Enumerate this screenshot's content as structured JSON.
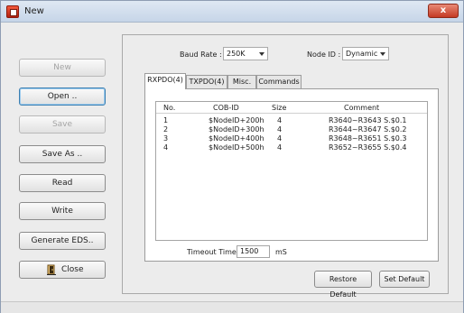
{
  "window": {
    "title": "New",
    "close_glyph": "x"
  },
  "sidebar": {
    "new": "New",
    "open": "Open ..",
    "save": "Save",
    "save_as": "Save As ..",
    "read": "Read",
    "write": "Write",
    "generate_eds": "Generate EDS..",
    "close": "Close"
  },
  "settings": {
    "baud_rate_label": "Baud Rate :",
    "baud_rate_value": "250K",
    "node_id_label": "Node ID :",
    "node_id_value": "Dynamic"
  },
  "tabs": [
    "RXPDO(4)",
    "TXPDO(4)",
    "Misc.",
    "Commands"
  ],
  "table": {
    "columns": [
      "No.",
      "COB-ID",
      "Size",
      "Comment"
    ],
    "rows": [
      [
        "1",
        "$NodeID+200h",
        "4",
        "R3640~R3643 S.$0.1"
      ],
      [
        "2",
        "$NodeID+300h",
        "4",
        "R3644~R3647 S.$0.2"
      ],
      [
        "3",
        "$NodeID+400h",
        "4",
        "R3648~R3651 S.$0.3"
      ],
      [
        "4",
        "$NodeID+500h",
        "4",
        "R3652~R3655 S.$0.4"
      ]
    ]
  },
  "timeout": {
    "label": "Timeout Time:",
    "value": "1500",
    "unit": "mS"
  },
  "buttons": {
    "restore_default": "Restore Default",
    "set_default": "Set Default"
  },
  "icons": {
    "app": "app-icon",
    "close": "close-icon",
    "exit": "exit-door-icon"
  },
  "colors": {
    "title_close": "#c43a24",
    "focus_border": "#3c7fb1"
  }
}
